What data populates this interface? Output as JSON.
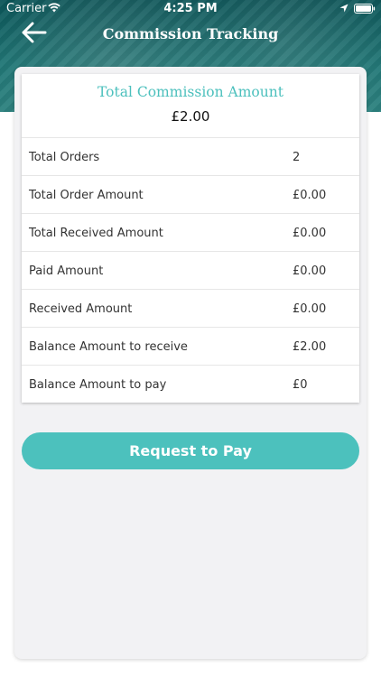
{
  "status_bar": {
    "carrier": "Carrier",
    "time": "4:25 PM"
  },
  "nav": {
    "title": "Commission Tracking",
    "back_icon": "arrow-left-icon"
  },
  "summary": {
    "title": "Total Commission Amount",
    "amount": "£2.00"
  },
  "rows": [
    {
      "label": "Total Orders",
      "value": "2"
    },
    {
      "label": "Total Order Amount",
      "value": "£0.00"
    },
    {
      "label": "Total Received Amount",
      "value": "£0.00"
    },
    {
      "label": "Paid Amount",
      "value": "£0.00"
    },
    {
      "label": "Received Amount",
      "value": "£0.00"
    },
    {
      "label": "Balance Amount to receive",
      "value": "£2.00"
    },
    {
      "label": "Balance Amount to pay",
      "value": "£0"
    }
  ],
  "actions": {
    "request_label": "Request to Pay"
  },
  "colors": {
    "accent": "#4cc1bd",
    "header": "#1f8c8c",
    "panel_bg": "#f2f2f4"
  }
}
